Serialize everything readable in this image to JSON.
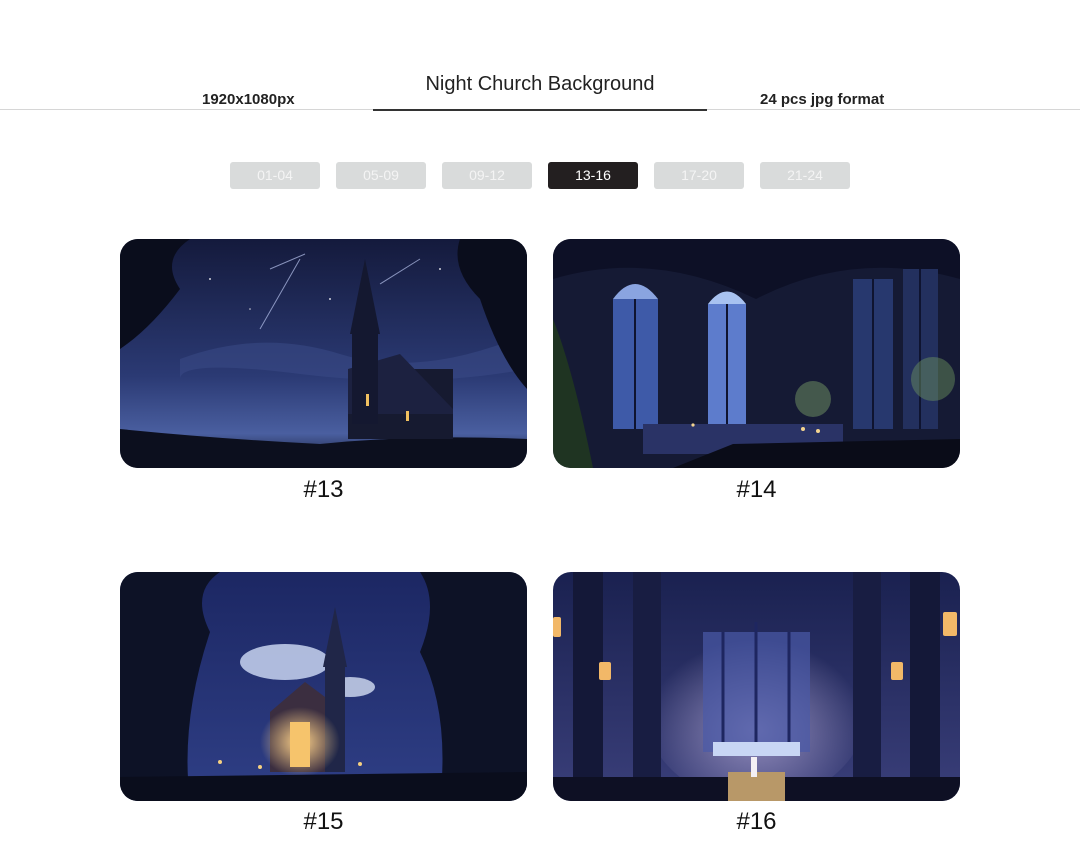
{
  "header": {
    "resolution": "1920x1080px",
    "title": "Night Church Background",
    "format": "24 pcs jpg format"
  },
  "tabs": [
    {
      "label": "01-04",
      "active": false
    },
    {
      "label": "05-09",
      "active": false
    },
    {
      "label": "09-12",
      "active": false
    },
    {
      "label": "13-16",
      "active": true
    },
    {
      "label": "17-20",
      "active": false
    },
    {
      "label": "21-24",
      "active": false
    }
  ],
  "gallery": [
    {
      "caption": "#13",
      "scene": "church-on-hill-night-sky"
    },
    {
      "caption": "#14",
      "scene": "gothic-chapel-interior-stained-windows"
    },
    {
      "caption": "#15",
      "scene": "forest-church-lit-doorway"
    },
    {
      "caption": "#16",
      "scene": "cathedral-nave-altar-lanterns"
    }
  ],
  "colors": {
    "active_tab": "#231f20",
    "inactive_tab": "#d9dbdb",
    "night_blue": "#1b2450"
  }
}
